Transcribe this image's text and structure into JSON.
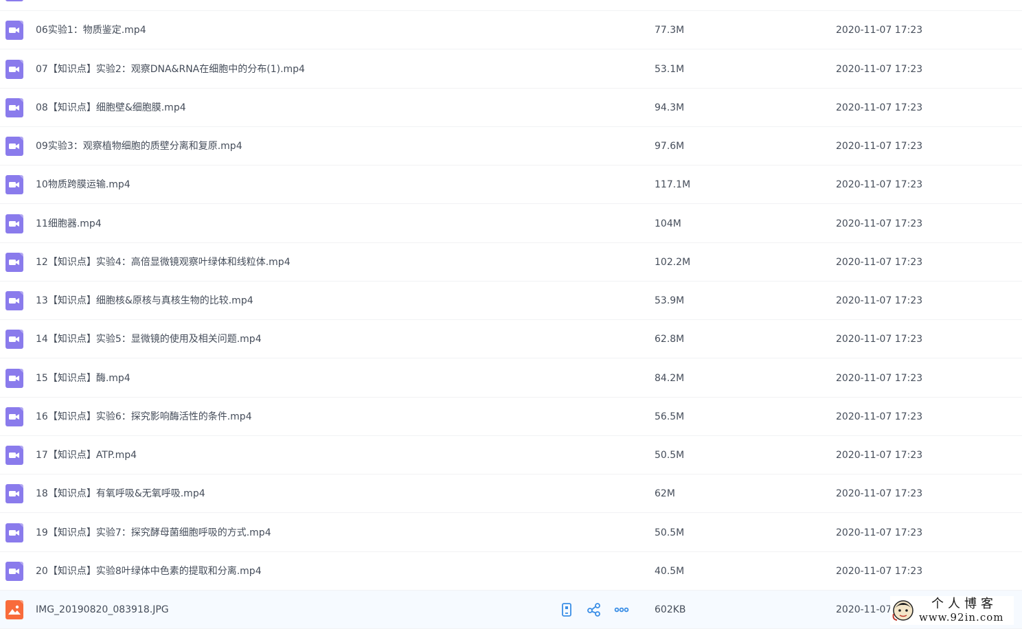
{
  "files": [
    {
      "name": "",
      "size": "",
      "date": "",
      "type": "video"
    },
    {
      "name": "06实验1：物质鉴定.mp4",
      "size": "77.3M",
      "date": "2020-11-07 17:23",
      "type": "video"
    },
    {
      "name": "07【知识点】实验2：观察DNA&RNA在细胞中的分布(1).mp4",
      "size": "53.1M",
      "date": "2020-11-07 17:23",
      "type": "video"
    },
    {
      "name": "08【知识点】细胞壁&细胞膜.mp4",
      "size": "94.3M",
      "date": "2020-11-07 17:23",
      "type": "video"
    },
    {
      "name": "09实验3：观察植物细胞的质壁分离和复原.mp4",
      "size": "97.6M",
      "date": "2020-11-07 17:23",
      "type": "video"
    },
    {
      "name": "10物质跨膜运输.mp4",
      "size": "117.1M",
      "date": "2020-11-07 17:23",
      "type": "video"
    },
    {
      "name": "11细胞器.mp4",
      "size": "104M",
      "date": "2020-11-07 17:23",
      "type": "video"
    },
    {
      "name": "12【知识点】实验4：高倍显微镜观察叶绿体和线粒体.mp4",
      "size": "102.2M",
      "date": "2020-11-07 17:23",
      "type": "video"
    },
    {
      "name": "13【知识点】细胞核&原核与真核生物的比较.mp4",
      "size": "53.9M",
      "date": "2020-11-07 17:23",
      "type": "video"
    },
    {
      "name": "14【知识点】实验5：显微镜的使用及相关问题.mp4",
      "size": "62.8M",
      "date": "2020-11-07 17:23",
      "type": "video"
    },
    {
      "name": "15【知识点】酶.mp4",
      "size": "84.2M",
      "date": "2020-11-07 17:23",
      "type": "video"
    },
    {
      "name": "16【知识点】实验6：探究影响酶活性的条件.mp4",
      "size": "56.5M",
      "date": "2020-11-07 17:23",
      "type": "video"
    },
    {
      "name": "17【知识点】ATP.mp4",
      "size": "50.5M",
      "date": "2020-11-07 17:23",
      "type": "video"
    },
    {
      "name": "18【知识点】有氧呼吸&无氧呼吸.mp4",
      "size": "62M",
      "date": "2020-11-07 17:23",
      "type": "video"
    },
    {
      "name": "19【知识点】实验7：探究酵母菌细胞呼吸的方式.mp4",
      "size": "50.5M",
      "date": "2020-11-07 17:23",
      "type": "video"
    },
    {
      "name": "20【知识点】实验8叶绿体中色素的提取和分离.mp4",
      "size": "40.5M",
      "date": "2020-11-07 17:23",
      "type": "video"
    },
    {
      "name": "IMG_20190820_083918.JPG",
      "size": "602KB",
      "date": "2020-11-07",
      "type": "image",
      "selected": true
    }
  ],
  "row_actions": {
    "icons": [
      "phone-icon",
      "share-icon",
      "more-icon"
    ]
  },
  "watermark": {
    "title": "个人博客",
    "url": "www.92in.com"
  },
  "colors": {
    "video_icon": "#8a7bec",
    "image_icon": "#f86b3b",
    "action_blue": "#3a8ee6",
    "selected_row": "#f6faff"
  }
}
